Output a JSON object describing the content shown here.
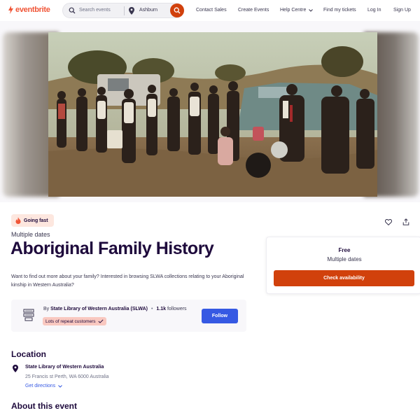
{
  "header": {
    "logo_text": "eventbrite",
    "search_placeholder": "Search events",
    "location": "Ashburn",
    "nav": {
      "contact_sales": "Contact Sales",
      "create_events": "Create Events",
      "help_centre": "Help Centre",
      "find_tickets": "Find my tickets",
      "log_in": "Log In",
      "sign_up": "Sign Up"
    }
  },
  "event": {
    "badge": "Going fast",
    "dates_label": "Multiple dates",
    "title": "Aboriginal Family History",
    "summary": "Want to find out more about your family? Interested in browsing SLWA collections relating to your Aboriginal kinship in Western Australia?"
  },
  "organizer": {
    "by_prefix": "By",
    "name": "State Library of Western Australia (SLWA)",
    "followers_count": "1.1k",
    "followers_label": "followers",
    "repeat_badge": "Lots of repeat customers",
    "follow_label": "Follow"
  },
  "ticket": {
    "price": "Free",
    "dates": "Multiple dates",
    "cta": "Check availability"
  },
  "location": {
    "heading": "Location",
    "venue": "State Library of Western Australia",
    "address": "25 Francis st Perth, WA 6000 Australia",
    "directions": "Get directions"
  },
  "about": {
    "heading": "About this event"
  },
  "colors": {
    "brand_orange": "#f05537",
    "cta_orange": "#d1410c",
    "follow_blue": "#3659e3",
    "title_ink": "#1e0a3c"
  },
  "icons": [
    "eventbrite-logo-icon",
    "search-icon",
    "location-pin-icon",
    "chevron-down-icon",
    "fire-icon",
    "heart-icon",
    "share-icon",
    "organizer-logo-icon",
    "check-icon"
  ]
}
